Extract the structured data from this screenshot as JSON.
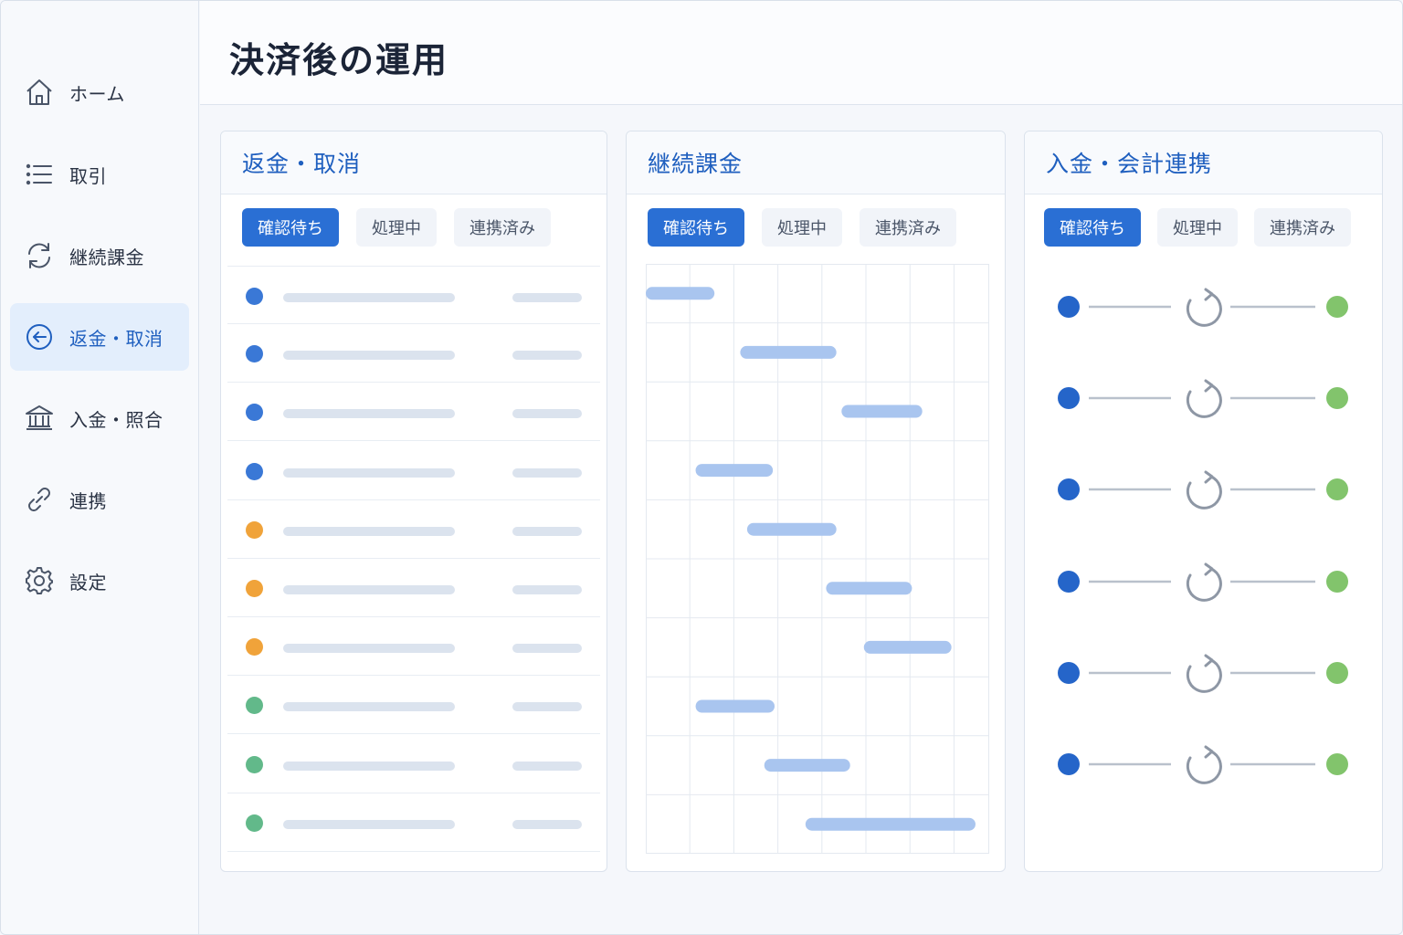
{
  "page": {
    "title": "決済後の運用"
  },
  "sidebar": {
    "items": [
      {
        "label": "ホーム",
        "icon": "home-icon"
      },
      {
        "label": "取引",
        "icon": "list-icon"
      },
      {
        "label": "継続課金",
        "icon": "refresh-icon"
      },
      {
        "label": "返金・取消",
        "icon": "arrow-left-circle-icon",
        "active": true
      },
      {
        "label": "入金・照合",
        "icon": "bank-icon"
      },
      {
        "label": "連携",
        "icon": "link-icon"
      },
      {
        "label": "設定",
        "icon": "gear-icon"
      }
    ]
  },
  "tabs": [
    "確認待ち",
    "処理中",
    "連携済み"
  ],
  "panels": {
    "refund": {
      "title": "返金・取消",
      "row_status": [
        "blue",
        "blue",
        "blue",
        "blue",
        "orange",
        "orange",
        "orange",
        "green",
        "green",
        "green"
      ]
    },
    "subscription": {
      "title": "継続課金",
      "gantt_bars": [
        {
          "start": 0.0,
          "end": 0.2
        },
        {
          "start": 0.275,
          "end": 0.555
        },
        {
          "start": 0.57,
          "end": 0.805
        },
        {
          "start": 0.145,
          "end": 0.37
        },
        {
          "start": 0.295,
          "end": 0.555
        },
        {
          "start": 0.525,
          "end": 0.775
        },
        {
          "start": 0.635,
          "end": 0.89
        },
        {
          "start": 0.145,
          "end": 0.375
        },
        {
          "start": 0.345,
          "end": 0.595
        },
        {
          "start": 0.465,
          "end": 0.96
        }
      ]
    },
    "payout": {
      "title": "入金・会計連携",
      "flow_rows": 6
    }
  },
  "colors": {
    "accent": "#2a6fd4",
    "status_blue": "#3a78d6",
    "status_orange": "#f0a33a",
    "status_green": "#62b98a",
    "flow_start": "#2565c9",
    "flow_end": "#82c46c",
    "gantt_bar": "#a9c5ef"
  }
}
